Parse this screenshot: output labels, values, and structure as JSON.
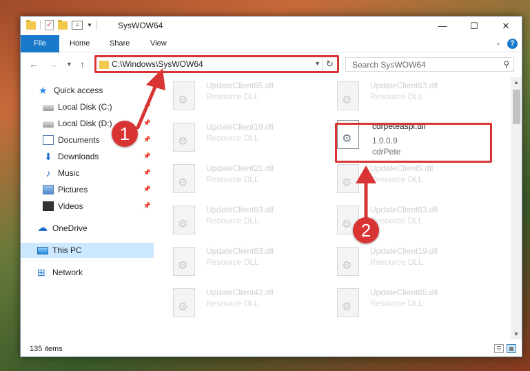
{
  "window": {
    "title": "SysWOW64",
    "controls": {
      "minimize": "—",
      "maximize": "☐",
      "close": "✕"
    }
  },
  "ribbon": {
    "tabs": [
      {
        "label": "File",
        "active": true
      },
      {
        "label": "Home"
      },
      {
        "label": "Share"
      },
      {
        "label": "View"
      }
    ],
    "help": "?"
  },
  "navigation": {
    "address": "C:\\Windows\\SysWOW64",
    "search_placeholder": "Search SysWOW64"
  },
  "sidebar": {
    "items": [
      {
        "label": "Quick access",
        "icon": "star-icon"
      },
      {
        "label": "Local Disk (C:)",
        "icon": "disk-icon",
        "pinned": true
      },
      {
        "label": "Local Disk (D:)",
        "icon": "disk-icon",
        "pinned": true
      },
      {
        "label": "Documents",
        "icon": "documents-icon",
        "pinned": true
      },
      {
        "label": "Downloads",
        "icon": "downloads-icon",
        "pinned": true
      },
      {
        "label": "Music",
        "icon": "music-icon",
        "pinned": true
      },
      {
        "label": "Pictures",
        "icon": "pictures-icon",
        "pinned": true
      },
      {
        "label": "Videos",
        "icon": "videos-icon",
        "pinned": true
      },
      {
        "label": "OneDrive",
        "icon": "onedrive-icon"
      },
      {
        "label": "This PC",
        "icon": "pc-icon",
        "selected": true
      },
      {
        "label": "Network",
        "icon": "network-icon"
      }
    ]
  },
  "files": [
    {
      "name": "UpdateClient65.dll",
      "desc": "Resource DLL"
    },
    {
      "name": "UpdateClient63.dll",
      "desc": "Resource DLL"
    },
    {
      "name": "UpdateClient19.dll",
      "desc": "Resource DLL"
    },
    {
      "name": "cdrpeteaspi.dll",
      "version": "1.0.0.9",
      "company": "cdrPete",
      "highlighted": true
    },
    {
      "name": "UpdateClient21.dll",
      "desc": "Resource DLL"
    },
    {
      "name": "UpdateClient5.dll",
      "desc": "Resource DLL"
    },
    {
      "name": "UpdateClient63.dll",
      "desc": "Resource DLL"
    },
    {
      "name": "UpdateClient63.dll",
      "desc": "Resource DLL"
    },
    {
      "name": "UpdateClient63.dll",
      "desc": "Resource DLL"
    },
    {
      "name": "UpdateClient19.dll",
      "desc": "Resource DLL"
    },
    {
      "name": "UpdateClient42.dll",
      "desc": "Resource DLL"
    },
    {
      "name": "UpdateClient65.dll",
      "desc": "Resource DLL"
    }
  ],
  "status": {
    "count": "135 items"
  },
  "annotations": [
    {
      "label": "1",
      "color": "#d83434"
    },
    {
      "label": "2",
      "color": "#d83434"
    }
  ]
}
